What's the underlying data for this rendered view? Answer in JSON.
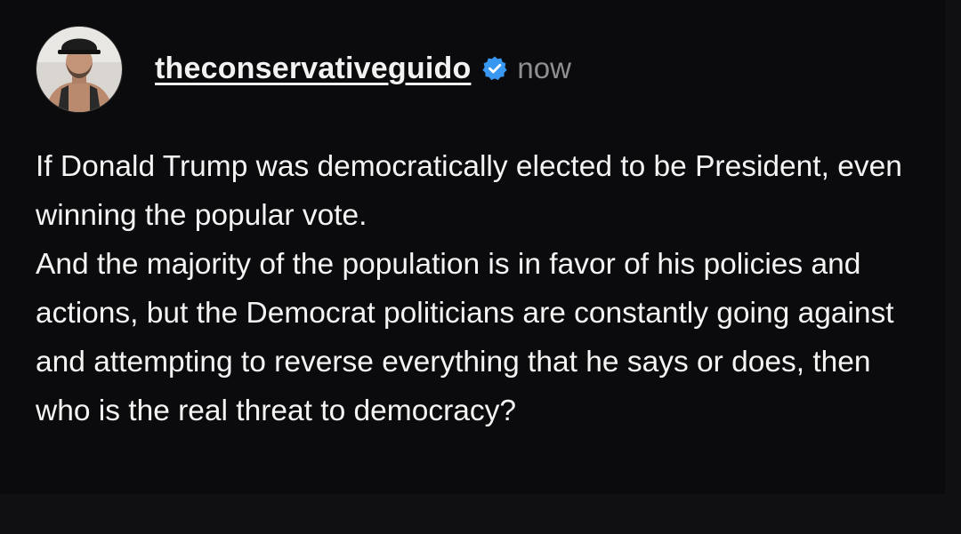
{
  "post": {
    "username": "theconservativeguido",
    "timestamp": "now",
    "verified": true,
    "avatar_icon": "profile-photo-icon",
    "verified_icon": "verified-badge-icon",
    "accent_color": "#3897f0",
    "paragraphs": [
      "If Donald Trump was democratically elected to be President, even winning the popular vote.",
      "And the majority of the population is in favor of his policies and actions, but the Democrat politicians are constantly going against and attempting to reverse everything that he says or does, then who is the real threat to democracy?"
    ]
  }
}
